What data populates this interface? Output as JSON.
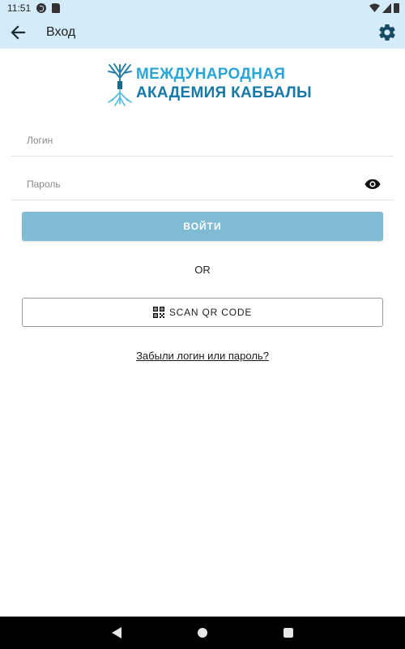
{
  "status_bar": {
    "time": "11:51"
  },
  "header": {
    "title": "Вход",
    "back_icon": "arrow-left-icon",
    "settings_icon": "gear-icon",
    "background_color": "#d4ecfa"
  },
  "logo": {
    "line1": "МЕЖДУНАРОДНАЯ",
    "line2": "АКАДЕМИЯ КАББАЛЫ",
    "icon": "tree-icon",
    "colors": {
      "line1": "#2aa5d8",
      "line2": "#1679a8"
    }
  },
  "form": {
    "login_placeholder": "Логин",
    "password_placeholder": "Пароль",
    "password_visibility_icon": "eye-icon",
    "login_button_label": "ВОЙТИ",
    "login_button_color": "#7fbcd3",
    "or_text": "OR",
    "scan_button_label": "SCAN QR CODE",
    "scan_icon": "qr-code-icon",
    "forgot_link": "Забыли логин или пароль?"
  },
  "nav_bar": {
    "back_icon": "triangle-back-icon",
    "home_icon": "circle-home-icon",
    "recent_icon": "square-recents-icon"
  }
}
